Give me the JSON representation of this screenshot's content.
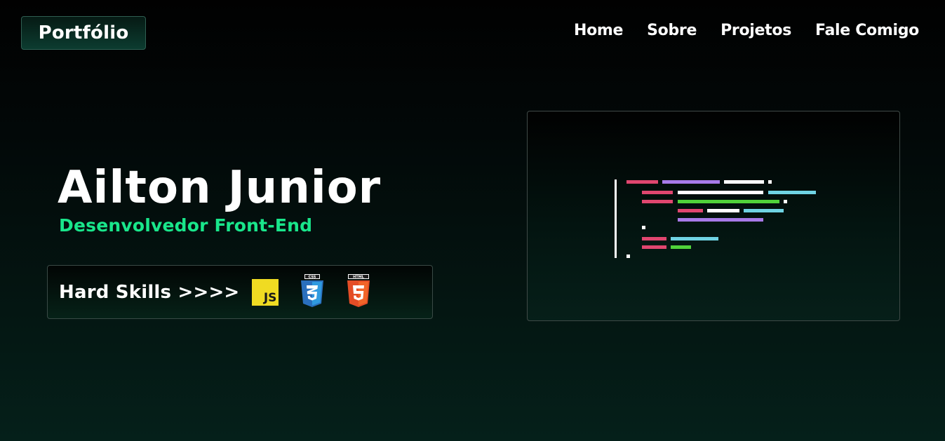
{
  "header": {
    "logo": "Portfólio",
    "nav": [
      "Home",
      "Sobre",
      "Projetos",
      "Fale Comigo"
    ]
  },
  "hero": {
    "name": "Ailton Junior",
    "role": "Desenvolvedor Front-End"
  },
  "skills": {
    "label": "Hard Skills >>>>",
    "icons": [
      {
        "name": "javascript-icon",
        "text": "JS",
        "color": "#f0db22"
      },
      {
        "name": "css3-icon",
        "text": "CSS",
        "color": "#2a6fbd"
      },
      {
        "name": "html5-icon",
        "text": "HTML",
        "color": "#e44d26"
      }
    ]
  },
  "code_illustration": {
    "icon": "code-editor-illustration",
    "colors": {
      "pink": "#e0466f",
      "purple": "#a77ae8",
      "white": "#ffffff",
      "cyan": "#6fd3e3",
      "green": "#50d23a"
    }
  },
  "colors": {
    "accent": "#19e68b",
    "logo_bg": "#0c3c30"
  }
}
